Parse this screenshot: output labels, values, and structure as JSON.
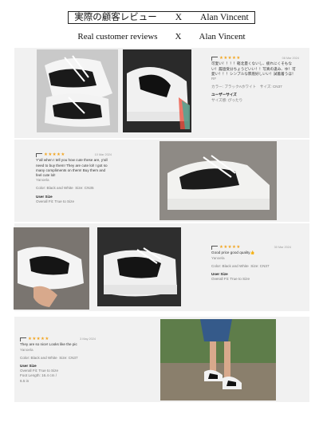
{
  "header": {
    "title_jp": "実際の顧客レビュー　　X　　Alan Vincent",
    "title_en": "Real customer reviews　　X　　Alan Vincent"
  },
  "reviews": [
    {
      "stars": "★★★★★",
      "date": "08 Mar 2024",
      "text": "可愛い！！！！軽北量くないし、疲れにくそもない！履過受分ちょうどいい！！写真の逢み、ゆ！可愛い！！！シンプルな厚底好しいい！試着着うほ！",
      "extra": "RF",
      "option_line": "カラー: ブラックAホワイト　サイズ: CN37",
      "size_heading": "ユーザーサイズ",
      "fit_line": "サイズ感: ぴったり"
    },
    {
      "stars": "★★★★★",
      "date": "10 Mar 2024",
      "text": "Y'all when I tell you how cute these are, y'all need to buy them! They are cute lol! I got so many compliments on them! Buy them and feel cute lol!",
      "reviewer": "Yanoela",
      "color_label": "Color: Black and White",
      "size_label": "Size: CN35",
      "user_size_heading": "User Size",
      "fit_line": "Overall Fit: True to Size"
    },
    {
      "stars": "★★★★★",
      "date": "30 Mar 2024",
      "text": "Good price good quality👍",
      "reviewer": "Yanoela",
      "color_label": "Color: Black and White",
      "size_label": "Size: CN37",
      "user_size_heading": "User Size",
      "fit_line": "Overall Fit: True to Size"
    },
    {
      "stars": "★★★★★",
      "date": "3 May 2024",
      "text": "They are so nice! Looks like the pic",
      "reviewer": "Yanoela",
      "color_label": "Color: Black and White",
      "size_label": "Size: CN37",
      "user_size_heading": "User Size",
      "fit_line": "Overall Fit: True to Size",
      "foot_line": "Foot Length: 16.4 cm /",
      "foot_line2": "6.5 in"
    }
  ],
  "photos": [
    "sneaker-photo-pair-top",
    "sneaker-photo-side-view",
    "sneaker-photo-product-gray",
    "sneaker-photo-hand-held",
    "sneaker-photo-close-up",
    "sneaker-photo-worn-outdoor"
  ],
  "colors": {
    "star": "#f2a623",
    "row_bg": "#f1f1f1"
  }
}
